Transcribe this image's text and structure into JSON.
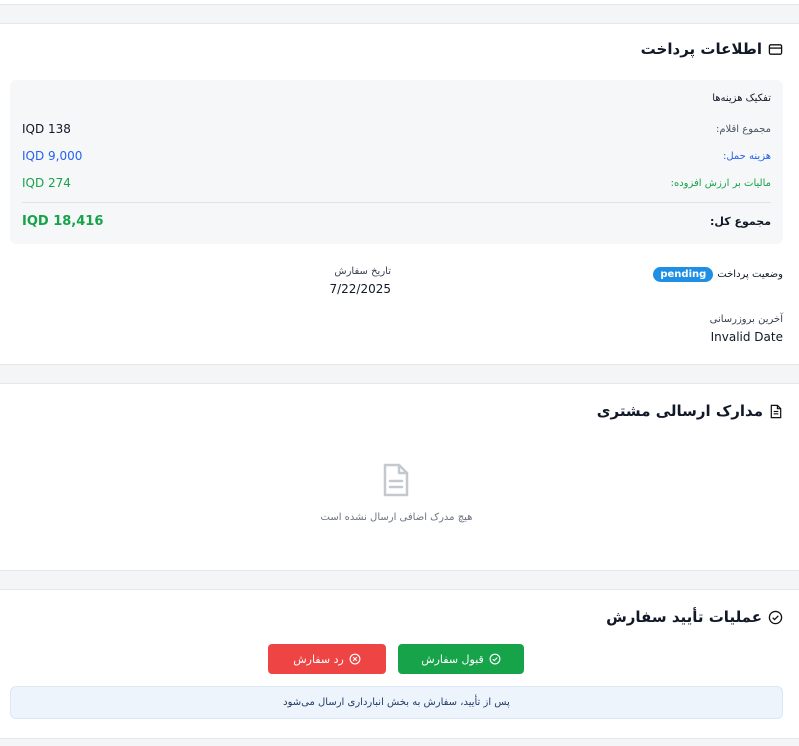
{
  "payment": {
    "title": "اطلاعات پرداخت",
    "breakdown_title": "تفکیک هزینه‌ها",
    "items_label": "مجموع اقلام:",
    "items_value": "IQD 138",
    "shipping_label": "هزینه حمل:",
    "shipping_value": "IQD 9,000",
    "vat_label": "مالیات بر ارزش افزوده:",
    "vat_value": "IQD 274",
    "total_label": "مجموع کل:",
    "total_value": "IQD 18,416",
    "status_label": "وضعیت پرداخت",
    "status_value": "pending",
    "order_date_label": "تاریخ سفارش",
    "order_date_value": "7/22/2025",
    "last_update_label": "آخرین بروزرسانی",
    "last_update_value": "Invalid Date"
  },
  "documents": {
    "title": "مدارک ارسالی مشتری",
    "empty_text": "هیچ مدرک اضافی ارسال نشده است"
  },
  "approval": {
    "title": "عملیات تأیید سفارش",
    "accept_label": "قبول سفارش",
    "reject_label": "رد سفارش",
    "note": "پس از تأیید، سفارش به بخش انبارداری ارسال می‌شود"
  },
  "colors": {
    "shipping": "#2563eb",
    "vat": "#16a34a",
    "total": "#16a34a",
    "accept": "#16a34a",
    "reject": "#ef4444",
    "badge": "#1f8fe6"
  },
  "icons": {
    "payment": "credit-card-icon",
    "documents": "document-icon",
    "approval": "check-circle-icon"
  }
}
